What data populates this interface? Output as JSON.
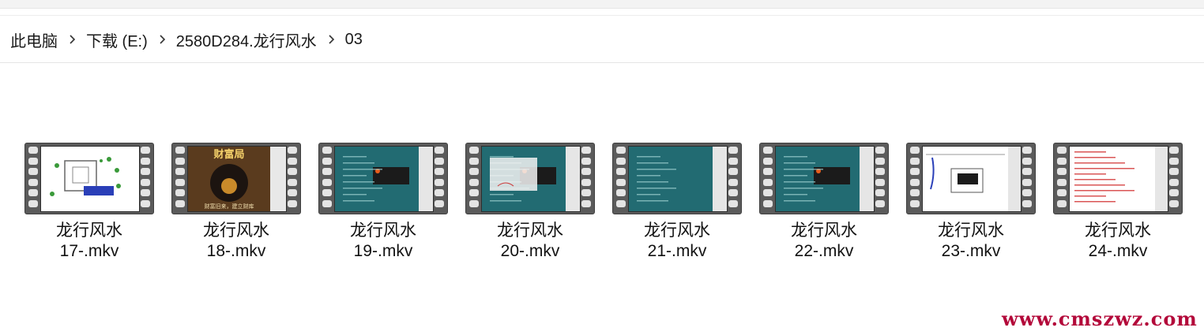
{
  "breadcrumb": {
    "items": [
      "此电脑",
      "下载 (E:)",
      "2580D284.龙行风水",
      "03"
    ],
    "separator_icon": "chevron-right-icon"
  },
  "files": [
    {
      "title": "龙行风水",
      "name": "17-.mkv",
      "thumb": "floorplan-white"
    },
    {
      "title": "龙行风水",
      "name": "18-.mkv",
      "thumb": "poster-brown"
    },
    {
      "title": "龙行风水",
      "name": "19-.mkv",
      "thumb": "teal-slide-text"
    },
    {
      "title": "龙行风水",
      "name": "20-.mkv",
      "thumb": "teal-slide-diagram"
    },
    {
      "title": "龙行风水",
      "name": "21-.mkv",
      "thumb": "teal-slide-plain"
    },
    {
      "title": "龙行风水",
      "name": "22-.mkv",
      "thumb": "teal-slide-text"
    },
    {
      "title": "龙行风水",
      "name": "23-.mkv",
      "thumb": "sketch-white"
    },
    {
      "title": "龙行风水",
      "name": "24-.mkv",
      "thumb": "red-text-white"
    }
  ],
  "thumb_texts": {
    "poster_title": "财富局",
    "poster_footer": "财富旧来，建立财库"
  },
  "file_icon": "video-film-icon",
  "watermark": "www.cmszwz.com",
  "colors": {
    "teal_slide": "#226b72",
    "poster_brown": "#5a3b1e",
    "watermark": "#b3093a",
    "film_dark": "#5b5b5b"
  }
}
